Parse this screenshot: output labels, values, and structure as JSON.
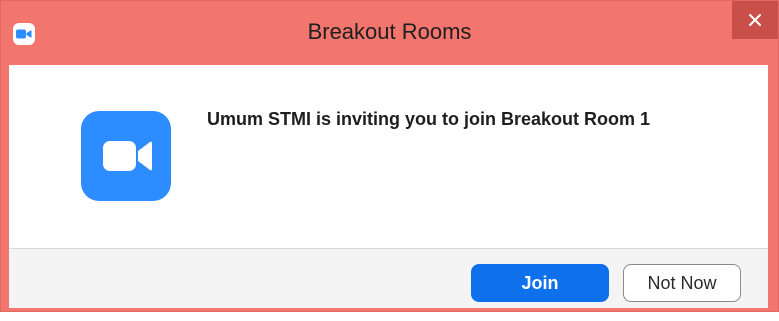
{
  "window": {
    "title": "Breakout Rooms",
    "app_icon": "zoom-camera-icon",
    "close_icon": "close-icon",
    "titlebar_color": "#f2766d",
    "close_button_color": "#c94f4a"
  },
  "dialog": {
    "logo_icon": "zoom-camera-icon",
    "logo_color": "#2d8cff",
    "message": "Umum STMI is inviting you to join Breakout Room 1"
  },
  "buttons": {
    "join_label": "Join",
    "join_color": "#0e71eb",
    "not_now_label": "Not Now"
  }
}
